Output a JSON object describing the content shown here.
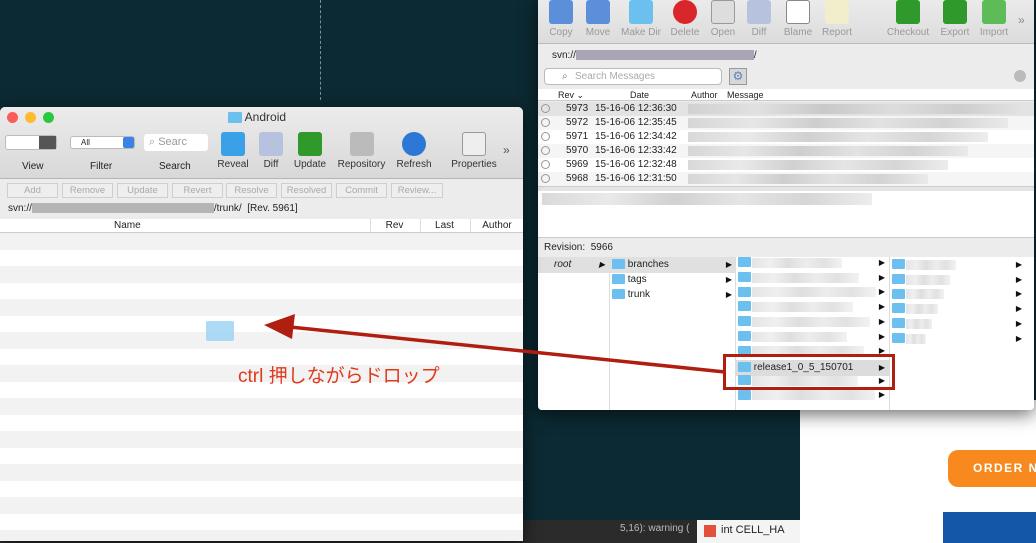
{
  "left_window": {
    "title": "Android",
    "toolbar": {
      "view": "View",
      "filter": "Filter",
      "filter_value": "All",
      "search": "Search",
      "search_placeholder": "Searc",
      "reveal": "Reveal",
      "diff": "Diff",
      "update": "Update",
      "repository": "Repository",
      "refresh": "Refresh",
      "properties": "Properties",
      "more": "»"
    },
    "actions": [
      "Add",
      "Remove",
      "Update",
      "Revert",
      "Resolve",
      "Resolved",
      "Commit",
      "Review..."
    ],
    "path_prefix": "svn://",
    "path_suffix": "/trunk/",
    "revision": "[Rev. 5961]",
    "columns": {
      "name": "Name",
      "rev": "Rev",
      "last": "Last",
      "author": "Author"
    }
  },
  "annotation": {
    "text": "ctrl 押しながらドロップ",
    "color": "#e03a1e"
  },
  "right_window": {
    "toolbar": [
      "Copy",
      "Move",
      "Make Dir",
      "Delete",
      "Open",
      "Diff",
      "Blame",
      "Report",
      "Checkout",
      "Export",
      "Import"
    ],
    "more": "»",
    "path_prefix": "svn://",
    "path_suffix": "/",
    "search_placeholder": "Search Messages",
    "columns": {
      "rev": "Rev",
      "date": "Date",
      "author": "Author",
      "message": "Message"
    },
    "log": [
      {
        "rev": "5973",
        "date": "15-16-06 12:36:30"
      },
      {
        "rev": "5972",
        "date": "15-16-06 12:35:45"
      },
      {
        "rev": "5971",
        "date": "15-16-06 12:34:42"
      },
      {
        "rev": "5970",
        "date": "15-16-06 12:33:42"
      },
      {
        "rev": "5969",
        "date": "15-16-06 12:32:48"
      },
      {
        "rev": "5968",
        "date": "15-16-06 12:31:50"
      }
    ],
    "revision_label": "Revision:",
    "revision_value": "5966",
    "root": "root",
    "folders": [
      "branches",
      "tags",
      "trunk"
    ],
    "highlighted_branch": "release1_0_5_150701"
  },
  "background": {
    "console_text": "5,16): warning (",
    "code_text": "int CELL_HA",
    "order_button": "ORDER N"
  }
}
